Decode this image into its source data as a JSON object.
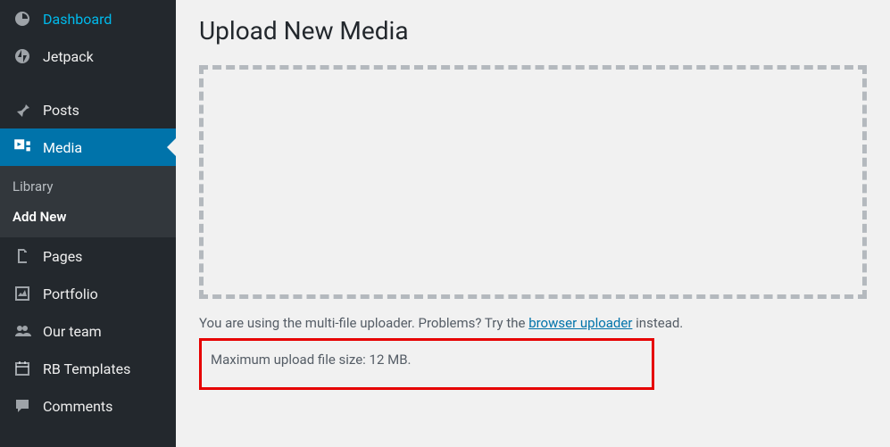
{
  "sidebar": {
    "dashboard": "Dashboard",
    "jetpack": "Jetpack",
    "posts": "Posts",
    "media": "Media",
    "media_sub_library": "Library",
    "media_sub_addnew": "Add New",
    "pages": "Pages",
    "portfolio": "Portfolio",
    "ourteam": "Our team",
    "rbtemplates": "RB Templates",
    "comments": "Comments"
  },
  "main": {
    "title": "Upload New Media",
    "helper_prefix": "You are using the multi-file uploader. Problems? Try the ",
    "helper_link": "browser uploader",
    "helper_suffix": " instead.",
    "max_size": "Maximum upload file size: 12 MB."
  }
}
